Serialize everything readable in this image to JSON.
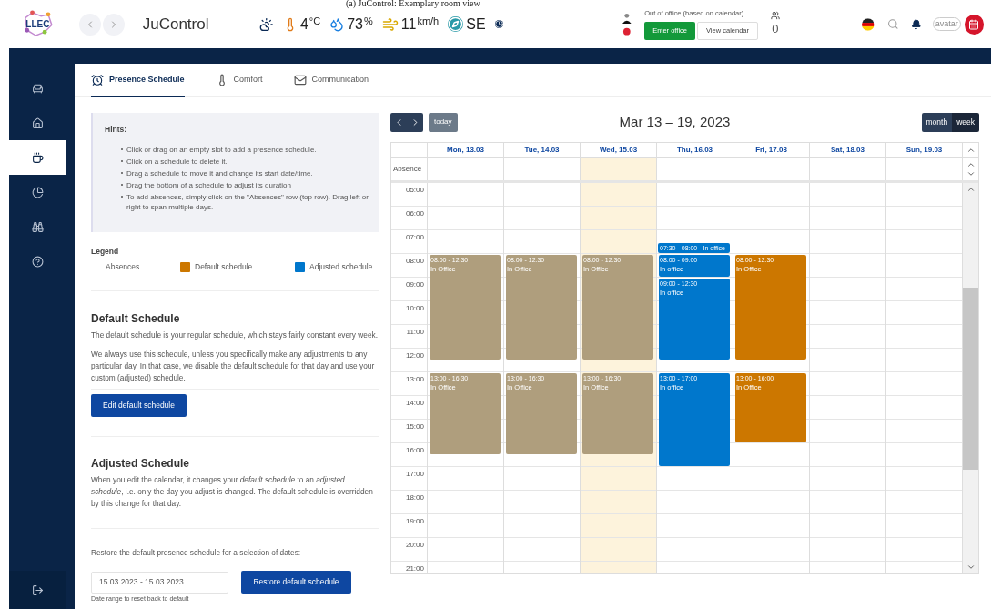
{
  "caption": "(a) JuControl: Exemplary room view",
  "header": {
    "logo": "LLEC",
    "title": "JuControl",
    "weather": [
      {
        "kind": "temperature",
        "value": "4",
        "unit": "°C"
      },
      {
        "kind": "humidity",
        "value": "73",
        "unit": "%"
      },
      {
        "kind": "wind",
        "value": "11",
        "unit": "km/h"
      },
      {
        "kind": "direction",
        "value": "SE"
      }
    ],
    "presence_status": "Out of office (based on calendar)",
    "enter_button": "Enter office",
    "calendar_button": "View calendar",
    "people_count": "0",
    "avatar": "avatar"
  },
  "sidebar": {
    "items": [
      {
        "kind": "sofa",
        "selected": false
      },
      {
        "kind": "home",
        "selected": false
      },
      {
        "kind": "coffee",
        "selected": true
      },
      {
        "kind": "chart",
        "selected": false
      },
      {
        "kind": "binoculars",
        "selected": false
      },
      {
        "kind": "help",
        "selected": false
      }
    ]
  },
  "tabs": [
    {
      "label": "Presence Schedule",
      "kind": "presence",
      "selected": true
    },
    {
      "label": "Comfort",
      "kind": "comfort",
      "selected": false
    },
    {
      "label": "Communication",
      "kind": "communication",
      "selected": false
    }
  ],
  "hints": {
    "title": "Hints:",
    "items": [
      "Click or drag on an empty slot to add a presence schedule.",
      "Click on a schedule to delete it.",
      "Drag a schedule to move it and change its start date/time.",
      "Drag the bottom of a schedule to adjust its duration",
      "To add absences, simply click on the \"Absences\" row (top row). Drag left or right to span multiple days."
    ]
  },
  "legend": {
    "title": "Legend",
    "items": [
      {
        "label": "Absences"
      },
      {
        "label": "Default schedule",
        "color": "#cc7700"
      },
      {
        "label": "Adjusted schedule",
        "color": "#0077cc"
      }
    ]
  },
  "default_schedule": {
    "heading": "Default Schedule",
    "paragraphs": [
      "The default schedule is your regular schedule, which stays fairly constant every week.",
      "We always use this schedule, unless you specifically make any adjustments to any particular day. In that case, we disable the default schedule for that day and use your custom (adjusted) schedule."
    ],
    "button": "Edit default schedule"
  },
  "adjusted_schedule": {
    "heading": "Adjusted Schedule",
    "paragraphs": [
      "When you edit the calendar, it changes your *default schedule* to an *adjusted schedule*, i.e. only the day you adjust is changed. The default schedule is overridden by this change for that day."
    ]
  },
  "restore": {
    "text": "Restore the default presence schedule for a selection of dates:",
    "date_range": "15.03.2023 - 15.03.2023",
    "button": "Restore default schedule",
    "helper": "Date range to reset back to default"
  },
  "calendar": {
    "today_button": "today",
    "title": "Mar 13 – 19, 2023",
    "views": [
      {
        "label": "month",
        "selected": false
      },
      {
        "label": "week",
        "selected": true
      }
    ],
    "absence_label": "Absence",
    "hours": [
      "05:00",
      "06:00",
      "07:00",
      "08:00",
      "09:00",
      "10:00",
      "11:00",
      "12:00",
      "13:00",
      "14:00",
      "15:00",
      "16:00",
      "17:00",
      "18:00",
      "19:00",
      "20:00",
      "21:00"
    ],
    "days": [
      {
        "label": "Mon, 13.03",
        "today": false,
        "events": [
          {
            "kind": "block",
            "time": "08:00 - 12:30",
            "label": "In Office",
            "color": "#af9e7d"
          },
          {
            "kind": "block",
            "time": "13:00 - 16:30",
            "label": "In Office",
            "color": "#af9e7d"
          }
        ]
      },
      {
        "label": "Tue, 14.03",
        "today": false,
        "events": [
          {
            "kind": "block",
            "time": "08:00 - 12:30",
            "label": "In Office",
            "color": "#af9e7d"
          },
          {
            "kind": "block",
            "time": "13:00 - 16:30",
            "label": "In Office",
            "color": "#af9e7d"
          }
        ]
      },
      {
        "label": "Wed, 15.03",
        "today": true,
        "events": [
          {
            "kind": "block",
            "time": "08:00 - 12:30",
            "label": "In Office",
            "color": "#af9e7d"
          },
          {
            "kind": "block",
            "time": "13:00 - 16:30",
            "label": "In Office",
            "color": "#af9e7d"
          }
        ]
      },
      {
        "label": "Thu, 16.03",
        "today": false,
        "events": [
          {
            "kind": "inline",
            "text": "07:30 - 08:00 - In office",
            "color": "#0077cc"
          },
          {
            "kind": "block",
            "time": "08:00 - 09:00",
            "label": "In office",
            "color": "#0077cc"
          },
          {
            "kind": "block",
            "time": "09:00 - 12:30",
            "label": "In office",
            "color": "#0077cc"
          },
          {
            "kind": "block",
            "time": "13:00 - 17:00",
            "label": "In office",
            "color": "#0077cc"
          }
        ]
      },
      {
        "label": "Fri, 17.03",
        "today": false,
        "events": [
          {
            "kind": "block",
            "time": "08:00 - 12:30",
            "label": "In Office",
            "color": "#cc7700"
          },
          {
            "kind": "block",
            "time": "13:00 - 16:00",
            "label": "In Office",
            "color": "#cc7700"
          }
        ]
      },
      {
        "label": "Sat, 18.03",
        "today": false
      },
      {
        "label": "Sun, 19.03",
        "today": false
      }
    ]
  }
}
